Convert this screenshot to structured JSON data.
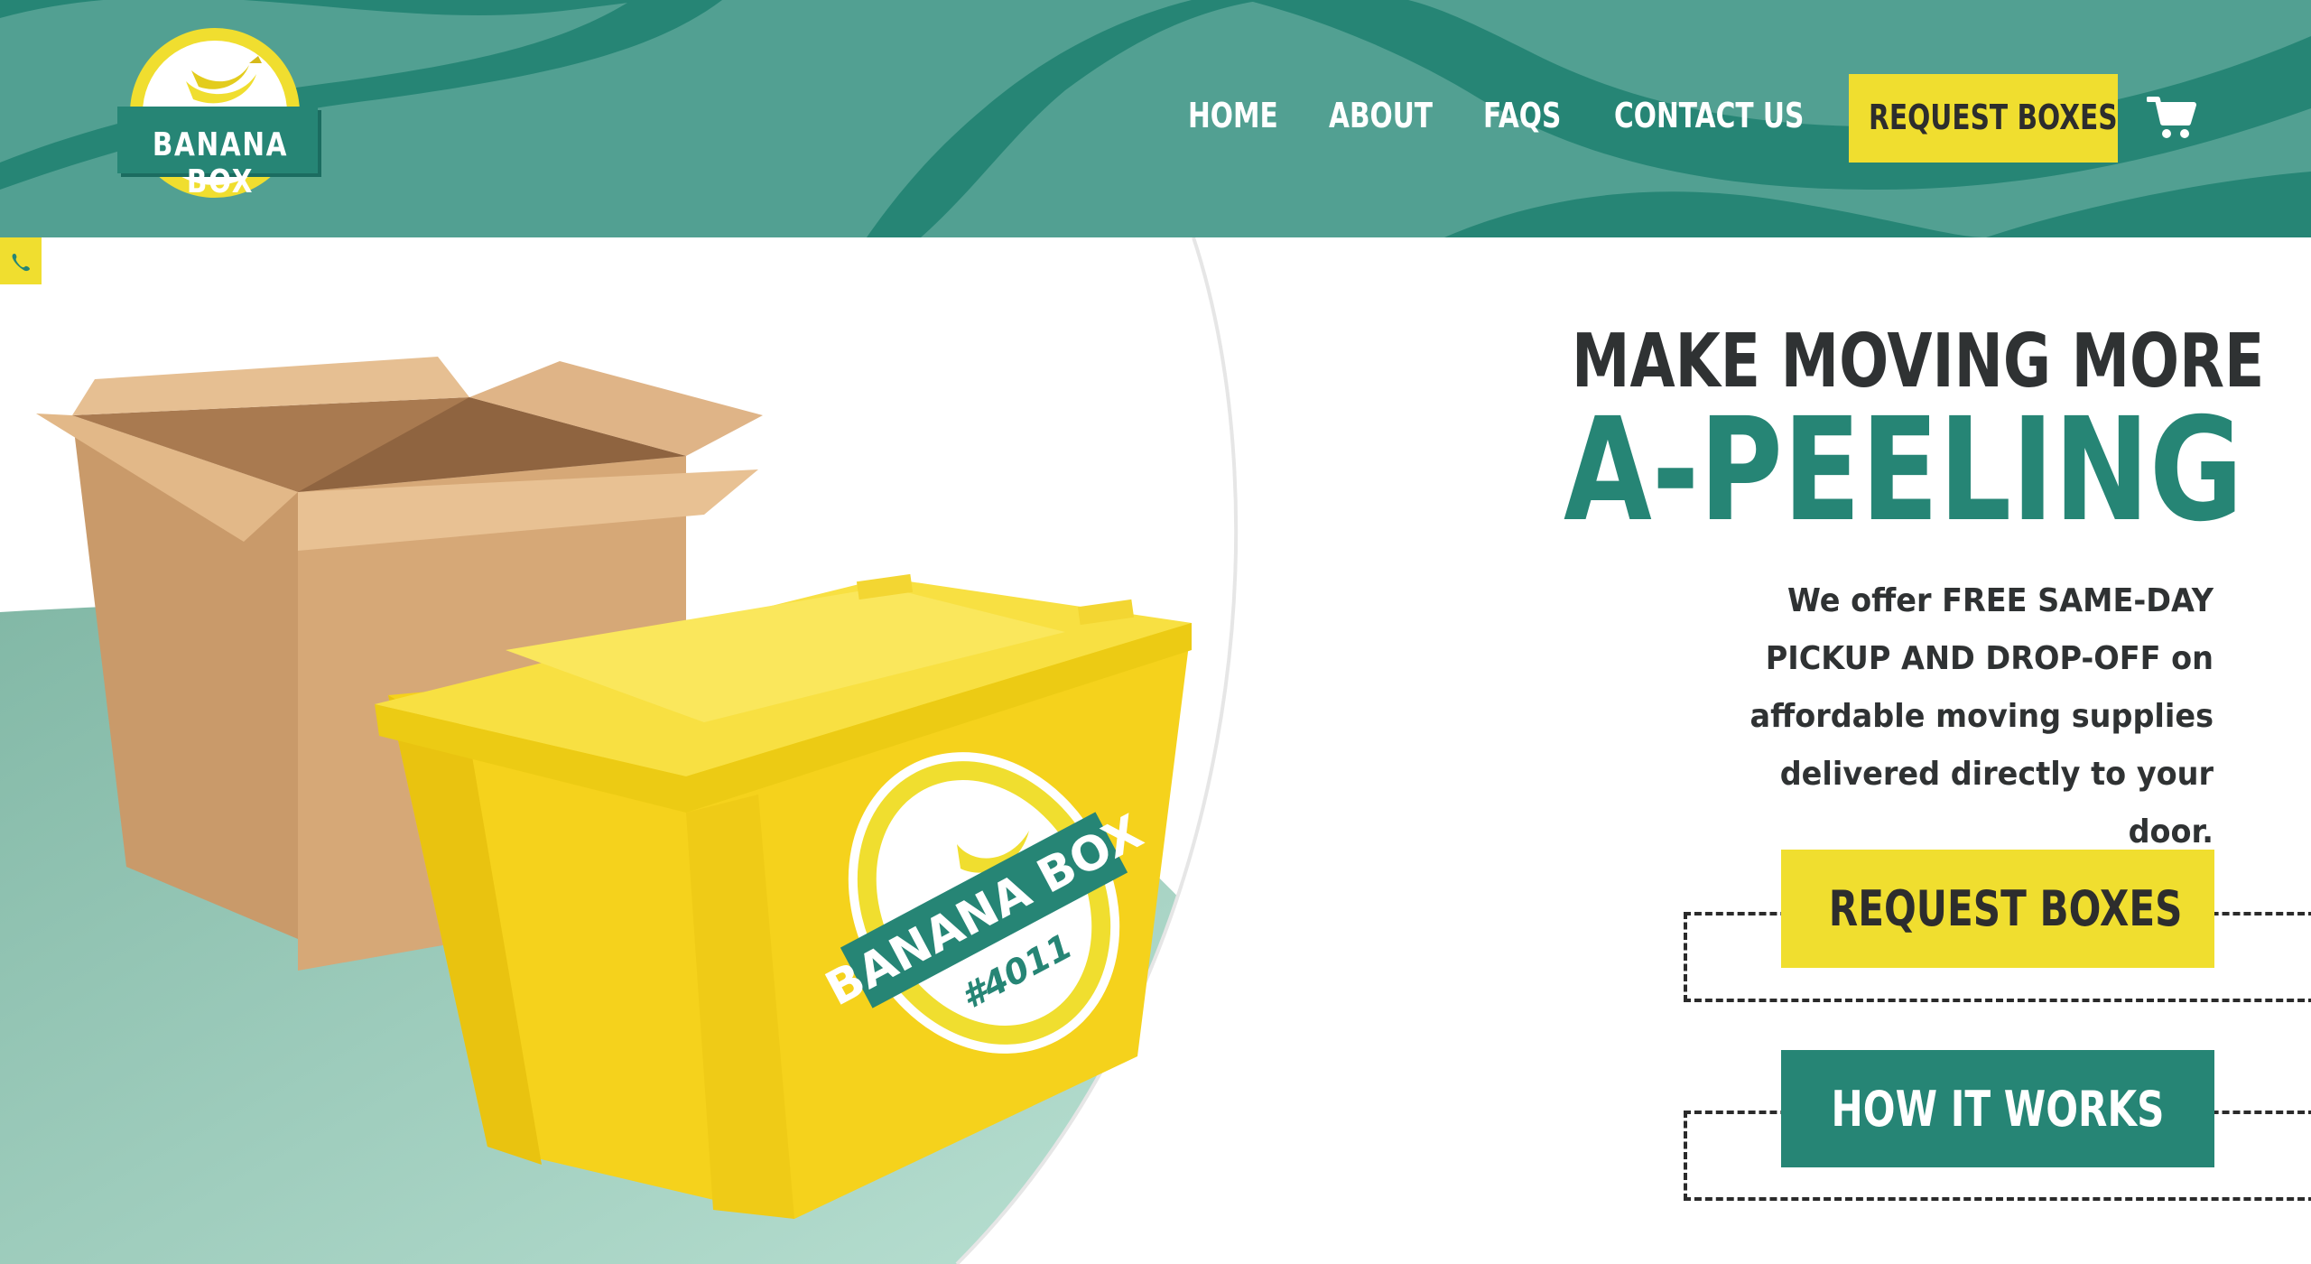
{
  "brand": {
    "name": "BANANA BOX",
    "colors": {
      "green": "#268575",
      "green_light": "#52a092",
      "yellow": "#f0de2f",
      "dark": "#2f3233"
    }
  },
  "nav": {
    "items": [
      {
        "label": "HOME"
      },
      {
        "label": "ABOUT"
      },
      {
        "label": "FAQS"
      },
      {
        "label": "CONTACT US"
      }
    ],
    "cta_label": "REQUEST BOXES",
    "cart_icon": "shopping-cart-icon",
    "phone_icon": "phone-icon"
  },
  "hero": {
    "kicker": "MAKE MOVING MORE",
    "headline": "A-PEELING",
    "lead": "We offer FREE SAME-DAY PICKUP AND DROP-OFF on affordable moving supplies delivered directly to your door.",
    "tote_label": "BANANA BOX",
    "tote_number": "#4011",
    "buttons": {
      "request": "REQUEST BOXES",
      "how": "HOW IT WORKS"
    }
  }
}
